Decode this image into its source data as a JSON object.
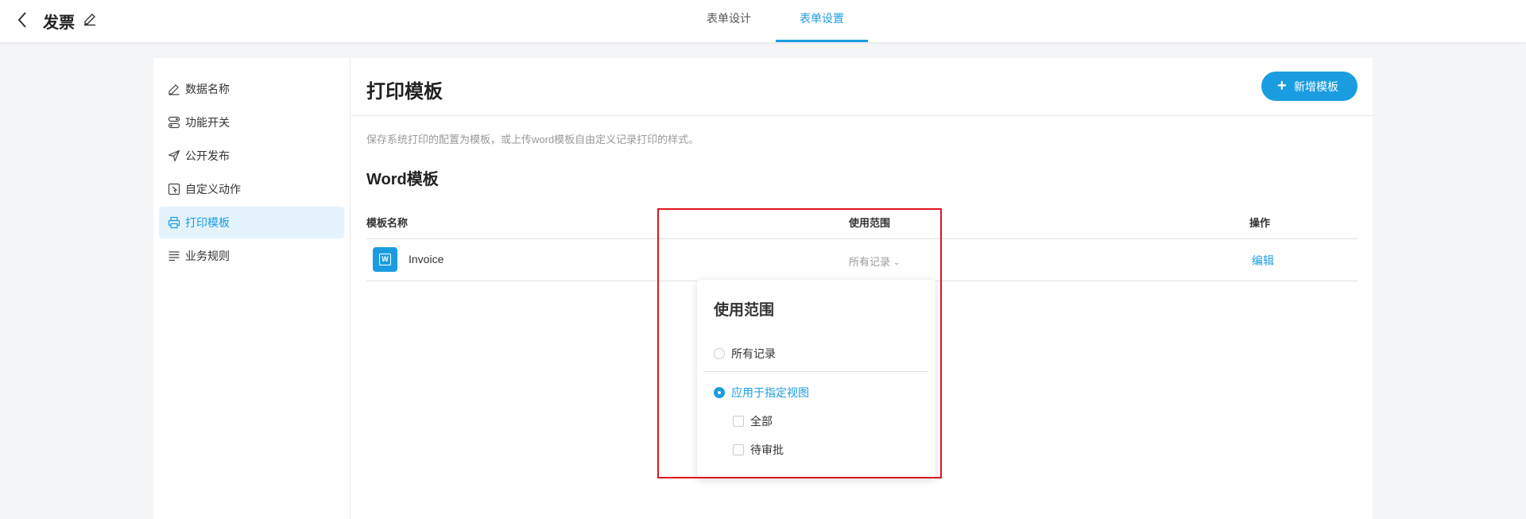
{
  "header": {
    "title": "发票",
    "tabs": [
      {
        "label": "表单设计"
      },
      {
        "label": "表单设置"
      }
    ]
  },
  "sidebar": {
    "items": [
      {
        "label": "数据名称",
        "icon": "pencil-icon"
      },
      {
        "label": "功能开关",
        "icon": "toggle-icon"
      },
      {
        "label": "公开发布",
        "icon": "send-icon"
      },
      {
        "label": "自定义动作",
        "icon": "custom-action-icon"
      },
      {
        "label": "打印模板",
        "icon": "printer-icon",
        "active": true
      },
      {
        "label": "业务规则",
        "icon": "rules-icon"
      }
    ]
  },
  "main": {
    "title": "打印模板",
    "add_button": "新增模板",
    "description": "保存系统打印的配置为模板，或上传word模板自由定义记录打印的样式。",
    "section_title": "Word模板",
    "table": {
      "columns": [
        "模板名称",
        "使用范围",
        "操作"
      ],
      "rows": [
        {
          "name": "Invoice",
          "scope": "所有记录",
          "action": "编辑"
        }
      ]
    }
  },
  "scope_dropdown": {
    "title": "使用范围",
    "options": [
      {
        "label": "所有记录",
        "selected": false
      },
      {
        "label": "应用于指定视图",
        "selected": true
      }
    ],
    "views": [
      {
        "label": "全部",
        "checked": false
      },
      {
        "label": "待审批",
        "checked": false
      }
    ]
  },
  "colors": {
    "accent": "#1a9de0",
    "highlight_box": "#e0141e"
  }
}
